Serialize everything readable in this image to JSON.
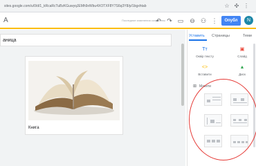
{
  "browser": {
    "url": "sites.google.com/u/0/d/1_kRcaRcTuBzKGuwyqJEMh9xWbu4XOTXF8Y7S6q3Y8/p/1bgxhtab",
    "star_icon": "star-icon",
    "extension_icon": "extension-icon",
    "menu_icon": "more-vert-icon"
  },
  "toolbar": {
    "site_name": "A",
    "save_status": "Последние изменения сохранены",
    "undo_icon": "undo-icon",
    "redo_icon": "redo-icon",
    "preview_icon": "preview-icon",
    "link_icon": "link-icon",
    "share_icon": "share-icon",
    "more_icon": "more-vert-icon",
    "publish_label": "Опубл",
    "profile_initial": "N",
    "accent_color": "#fbbc04",
    "publish_color": "#4285f4"
  },
  "canvas": {
    "title_text": "аница",
    "image_caption": "Книга"
  },
  "panel": {
    "tabs": [
      {
        "label": "Уставить",
        "active": true
      },
      {
        "label": "Страницы",
        "active": false
      },
      {
        "label": "Теми",
        "active": false
      }
    ],
    "tools": [
      {
        "icon": "text-box-icon",
        "glyph": "Tт",
        "label": "Оквір тексту",
        "color": "#1a73e8"
      },
      {
        "icon": "image-icon",
        "glyph": "▣",
        "label": "Слайд",
        "color": "#ea4335"
      },
      {
        "icon": "embed-icon",
        "glyph": "<>",
        "label": "Вставити",
        "color": "#fbbc04"
      },
      {
        "icon": "drive-icon",
        "glyph": "▲",
        "label": "Диск",
        "color": "#34a853"
      }
    ],
    "layouts_label": "Макети",
    "layouts_icon": "layouts-icon",
    "annotation_color": "#e53935"
  }
}
